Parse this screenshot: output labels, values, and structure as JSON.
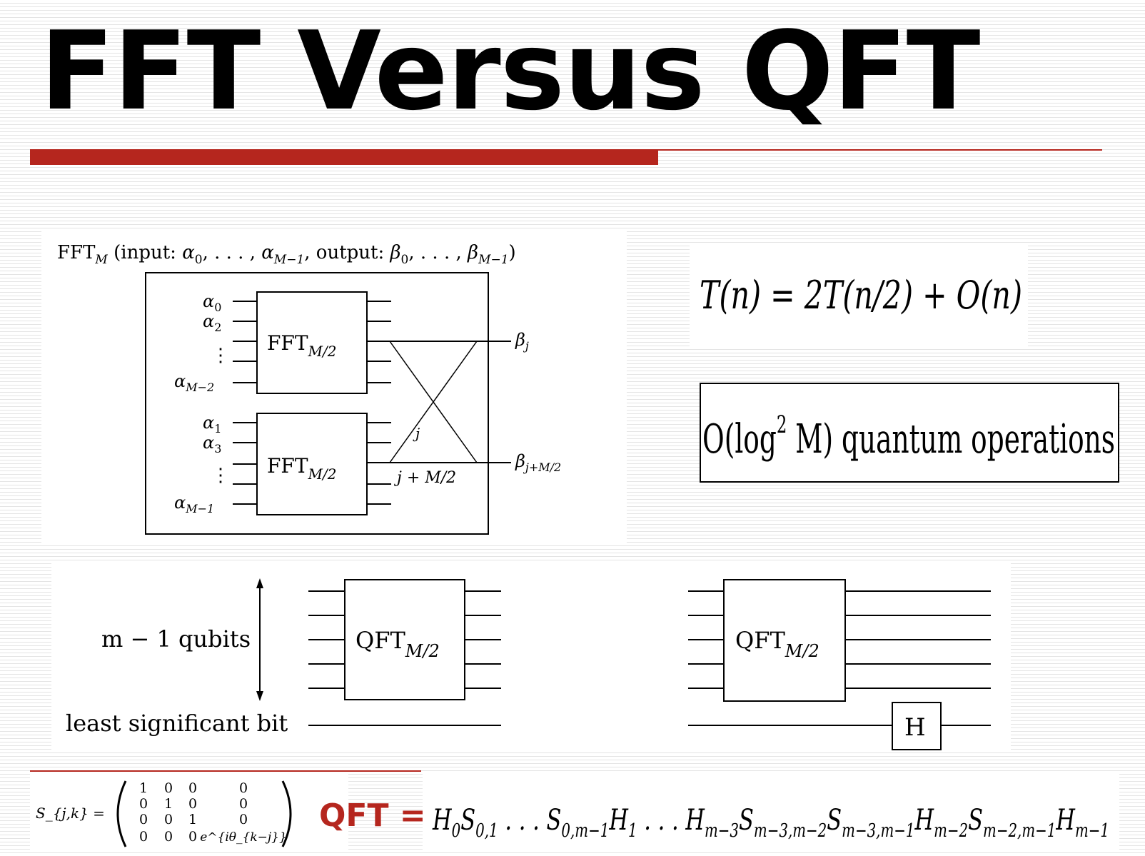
{
  "slide": {
    "title": "FFT Versus QFT",
    "accent_color": "#b5261e"
  },
  "fft_diagram": {
    "caption": "FFT_M (input: α_0, . . . , α_{M−1}, output: β_0, . . . , β_{M−1})",
    "caption_parts": {
      "fft": "FFT",
      "fft_sub": "M",
      "rest_open": " (input: ",
      "alpha": "α",
      "a0": "0",
      "dots1": ", . . . , ",
      "aM1": "M−1",
      "out": ", output: ",
      "beta": "β",
      "b0": "0",
      "dots2": ", . . . , ",
      "bM1": "M−1",
      "close": ")"
    },
    "upper_inputs": [
      "α_0",
      "α_2",
      "⋮",
      "α_{M−2}"
    ],
    "lower_inputs": [
      "α_1",
      "α_3",
      "⋮",
      "α_{M−1}"
    ],
    "sub_block_label": "FFT",
    "sub_block_subscript": "M/2",
    "crossing_labels": {
      "upper": "j",
      "lower": "j + M/2"
    },
    "outputs": {
      "upper": "β_j",
      "lower": "β_{j+M/2}"
    }
  },
  "recurrence": {
    "text": "T(n) = 2T(n/2) + O(n)"
  },
  "complexity": {
    "prefix": "O(log",
    "exponent": "2",
    "suffix": " M) quantum operations"
  },
  "qft_left": {
    "qubits_label": "m − 1 qubits",
    "lsb_label": "least significant bit",
    "block_label": "QFT",
    "block_subscript": "M/2"
  },
  "qft_right": {
    "block_label": "QFT",
    "block_subscript": "M/2",
    "gate_label": "H"
  },
  "matrix": {
    "lhs": "S_{j,k} =",
    "rows": [
      [
        "1",
        "0",
        "0",
        "0"
      ],
      [
        "0",
        "1",
        "0",
        "0"
      ],
      [
        "0",
        "0",
        "1",
        "0"
      ],
      [
        "0",
        "0",
        "0",
        "e^{iθ_{k−j}}"
      ]
    ]
  },
  "qft_formula": {
    "label": "QFT =",
    "product": "H_0 S_{0,1} . . . S_{0,m−1} H_1 . . . H_{m−3} S_{m−3,m−2} S_{m−3,m−1} H_{m−2} S_{m−2,m−1} H_{m−1}",
    "terms": [
      {
        "base": "H",
        "sub": "0"
      },
      {
        "base": "S",
        "sub": "0,1"
      },
      {
        "base": " . . . S",
        "sub": "0,m−1"
      },
      {
        "base": "H",
        "sub": "1"
      },
      {
        "base": " . . . H",
        "sub": "m−3"
      },
      {
        "base": "S",
        "sub": "m−3,m−2"
      },
      {
        "base": "S",
        "sub": "m−3,m−1"
      },
      {
        "base": "H",
        "sub": "m−2"
      },
      {
        "base": "S",
        "sub": "m−2,m−1"
      },
      {
        "base": "H",
        "sub": "m−1"
      }
    ]
  }
}
